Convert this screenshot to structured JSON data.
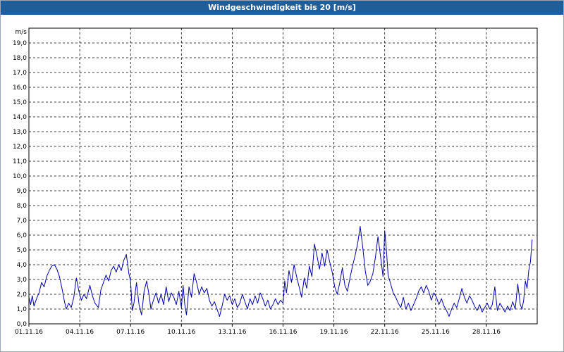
{
  "window": {
    "title": "Windgeschwindigkeit bis 20 [m/s]"
  },
  "chart_data": {
    "type": "line",
    "title": "Windgeschwindigkeit bis 20 [m/s]",
    "ylabel": "m/s",
    "xlabel": "",
    "ylim": [
      0,
      20
    ],
    "yticks": [
      "0,0",
      "1,0",
      "2,0",
      "3,0",
      "4,0",
      "5,0",
      "6,0",
      "7,0",
      "8,0",
      "9,0",
      "10,0",
      "11,0",
      "12,0",
      "13,0",
      "14,0",
      "15,0",
      "16,0",
      "17,0",
      "18,0",
      "19,0"
    ],
    "xlim": [
      0,
      30
    ],
    "xticks": [
      {
        "day": 0,
        "label": "01.11.16"
      },
      {
        "day": 3,
        "label": "04.11.16"
      },
      {
        "day": 6,
        "label": "07.11.16"
      },
      {
        "day": 9,
        "label": "10.11.16"
      },
      {
        "day": 12,
        "label": "13.11.16"
      },
      {
        "day": 15,
        "label": "16.11.16"
      },
      {
        "day": 18,
        "label": "19.11.16"
      },
      {
        "day": 21,
        "label": "22.11.16"
      },
      {
        "day": 24,
        "label": "25.11.16"
      },
      {
        "day": 27,
        "label": "28.11.16"
      }
    ],
    "grid": true,
    "line_color": "#0000aa",
    "series": [
      {
        "name": "",
        "points": [
          [
            0.0,
            1.8
          ],
          [
            0.1,
            1.3
          ],
          [
            0.2,
            1.9
          ],
          [
            0.3,
            1.2
          ],
          [
            0.45,
            1.7
          ],
          [
            0.6,
            2.1
          ],
          [
            0.75,
            2.8
          ],
          [
            0.9,
            2.5
          ],
          [
            1.05,
            3.2
          ],
          [
            1.2,
            3.6
          ],
          [
            1.35,
            3.9
          ],
          [
            1.5,
            4.0
          ],
          [
            1.65,
            3.7
          ],
          [
            1.8,
            3.2
          ],
          [
            1.95,
            2.4
          ],
          [
            2.1,
            1.5
          ],
          [
            2.2,
            1.0
          ],
          [
            2.35,
            1.4
          ],
          [
            2.5,
            1.1
          ],
          [
            2.65,
            1.8
          ],
          [
            2.8,
            3.1
          ],
          [
            2.95,
            2.2
          ],
          [
            3.1,
            1.6
          ],
          [
            3.25,
            2.0
          ],
          [
            3.4,
            1.7
          ],
          [
            3.6,
            2.6
          ],
          [
            3.75,
            1.9
          ],
          [
            3.9,
            1.4
          ],
          [
            4.1,
            1.1
          ],
          [
            4.25,
            2.3
          ],
          [
            4.4,
            2.8
          ],
          [
            4.55,
            3.3
          ],
          [
            4.7,
            2.9
          ],
          [
            4.85,
            3.6
          ],
          [
            5.0,
            3.9
          ],
          [
            5.15,
            3.5
          ],
          [
            5.3,
            4.0
          ],
          [
            5.45,
            3.6
          ],
          [
            5.6,
            4.3
          ],
          [
            5.75,
            4.7
          ],
          [
            5.9,
            3.4
          ],
          [
            6.0,
            2.9
          ],
          [
            6.1,
            0.9
          ],
          [
            6.2,
            1.4
          ],
          [
            6.35,
            2.8
          ],
          [
            6.5,
            1.3
          ],
          [
            6.65,
            0.6
          ],
          [
            6.8,
            2.2
          ],
          [
            6.95,
            2.9
          ],
          [
            7.1,
            1.9
          ],
          [
            7.2,
            1.0
          ],
          [
            7.35,
            1.6
          ],
          [
            7.5,
            2.1
          ],
          [
            7.65,
            1.4
          ],
          [
            7.8,
            2.0
          ],
          [
            7.95,
            1.3
          ],
          [
            8.1,
            2.5
          ],
          [
            8.25,
            1.5
          ],
          [
            8.4,
            2.1
          ],
          [
            8.55,
            1.8
          ],
          [
            8.7,
            1.3
          ],
          [
            8.85,
            2.2
          ],
          [
            9.0,
            1.1
          ],
          [
            9.1,
            2.6
          ],
          [
            9.2,
            1.3
          ],
          [
            9.3,
            0.6
          ],
          [
            9.45,
            2.5
          ],
          [
            9.6,
            1.8
          ],
          [
            9.75,
            3.4
          ],
          [
            9.9,
            2.8
          ],
          [
            10.05,
            2.0
          ],
          [
            10.2,
            2.5
          ],
          [
            10.35,
            2.1
          ],
          [
            10.5,
            2.4
          ],
          [
            10.65,
            1.6
          ],
          [
            10.8,
            1.2
          ],
          [
            10.95,
            1.5
          ],
          [
            11.1,
            1.0
          ],
          [
            11.25,
            0.5
          ],
          [
            11.4,
            1.2
          ],
          [
            11.55,
            2.0
          ],
          [
            11.7,
            1.6
          ],
          [
            11.85,
            1.9
          ],
          [
            12.0,
            1.3
          ],
          [
            12.15,
            1.7
          ],
          [
            12.3,
            1.1
          ],
          [
            12.45,
            1.4
          ],
          [
            12.6,
            2.0
          ],
          [
            12.75,
            1.5
          ],
          [
            12.9,
            1.0
          ],
          [
            13.05,
            1.7
          ],
          [
            13.2,
            1.3
          ],
          [
            13.35,
            1.9
          ],
          [
            13.5,
            1.4
          ],
          [
            13.65,
            2.1
          ],
          [
            13.8,
            1.7
          ],
          [
            13.95,
            1.2
          ],
          [
            14.1,
            1.6
          ],
          [
            14.25,
            1.0
          ],
          [
            14.4,
            1.3
          ],
          [
            14.55,
            1.7
          ],
          [
            14.7,
            1.3
          ],
          [
            14.85,
            1.6
          ],
          [
            15.0,
            1.4
          ],
          [
            15.1,
            2.9
          ],
          [
            15.2,
            2.1
          ],
          [
            15.35,
            3.6
          ],
          [
            15.5,
            2.8
          ],
          [
            15.65,
            4.0
          ],
          [
            15.8,
            3.2
          ],
          [
            15.95,
            2.5
          ],
          [
            16.1,
            1.8
          ],
          [
            16.25,
            3.1
          ],
          [
            16.4,
            2.4
          ],
          [
            16.55,
            3.9
          ],
          [
            16.7,
            3.2
          ],
          [
            16.85,
            5.4
          ],
          [
            17.0,
            4.6
          ],
          [
            17.15,
            3.7
          ],
          [
            17.3,
            4.8
          ],
          [
            17.45,
            3.9
          ],
          [
            17.6,
            5.0
          ],
          [
            17.75,
            4.2
          ],
          [
            17.9,
            3.5
          ],
          [
            18.05,
            2.5
          ],
          [
            18.2,
            2.0
          ],
          [
            18.35,
            2.8
          ],
          [
            18.5,
            3.8
          ],
          [
            18.65,
            2.6
          ],
          [
            18.8,
            2.2
          ],
          [
            18.95,
            3.1
          ],
          [
            19.1,
            3.9
          ],
          [
            19.25,
            4.6
          ],
          [
            19.4,
            5.4
          ],
          [
            19.55,
            6.6
          ],
          [
            19.7,
            5.2
          ],
          [
            19.85,
            3.6
          ],
          [
            20.0,
            2.6
          ],
          [
            20.15,
            2.9
          ],
          [
            20.3,
            3.4
          ],
          [
            20.45,
            4.5
          ],
          [
            20.6,
            5.9
          ],
          [
            20.75,
            4.6
          ],
          [
            20.9,
            3.2
          ],
          [
            21.0,
            6.3
          ],
          [
            21.1,
            5.0
          ],
          [
            21.2,
            3.3
          ],
          [
            21.35,
            2.7
          ],
          [
            21.5,
            2.1
          ],
          [
            21.65,
            1.8
          ],
          [
            21.8,
            1.4
          ],
          [
            21.95,
            1.1
          ],
          [
            22.1,
            1.8
          ],
          [
            22.25,
            1.0
          ],
          [
            22.4,
            1.4
          ],
          [
            22.55,
            0.9
          ],
          [
            22.7,
            1.3
          ],
          [
            22.85,
            1.7
          ],
          [
            23.0,
            2.2
          ],
          [
            23.15,
            2.5
          ],
          [
            23.3,
            2.1
          ],
          [
            23.45,
            2.6
          ],
          [
            23.6,
            2.2
          ],
          [
            23.75,
            1.6
          ],
          [
            23.9,
            2.1
          ],
          [
            24.05,
            1.8
          ],
          [
            24.2,
            1.3
          ],
          [
            24.35,
            1.7
          ],
          [
            24.5,
            1.2
          ],
          [
            24.65,
            0.9
          ],
          [
            24.8,
            0.5
          ],
          [
            24.95,
            1.0
          ],
          [
            25.1,
            1.4
          ],
          [
            25.25,
            1.1
          ],
          [
            25.4,
            1.7
          ],
          [
            25.55,
            2.4
          ],
          [
            25.7,
            1.8
          ],
          [
            25.85,
            1.4
          ],
          [
            26.0,
            1.9
          ],
          [
            26.15,
            1.6
          ],
          [
            26.3,
            1.2
          ],
          [
            26.45,
            0.9
          ],
          [
            26.6,
            1.3
          ],
          [
            26.75,
            0.8
          ],
          [
            26.9,
            1.1
          ],
          [
            27.05,
            1.4
          ],
          [
            27.2,
            1.0
          ],
          [
            27.35,
            1.3
          ],
          [
            27.5,
            2.5
          ],
          [
            27.65,
            0.9
          ],
          [
            27.8,
            1.4
          ],
          [
            27.95,
            1.1
          ],
          [
            28.1,
            0.8
          ],
          [
            28.25,
            1.2
          ],
          [
            28.4,
            0.9
          ],
          [
            28.55,
            1.5
          ],
          [
            28.7,
            1.0
          ],
          [
            28.85,
            2.7
          ],
          [
            29.0,
            1.3
          ],
          [
            29.1,
            1.0
          ],
          [
            29.2,
            1.6
          ],
          [
            29.3,
            2.9
          ],
          [
            29.4,
            2.4
          ],
          [
            29.5,
            3.6
          ],
          [
            29.6,
            4.2
          ],
          [
            29.7,
            5.7
          ]
        ]
      }
    ]
  }
}
